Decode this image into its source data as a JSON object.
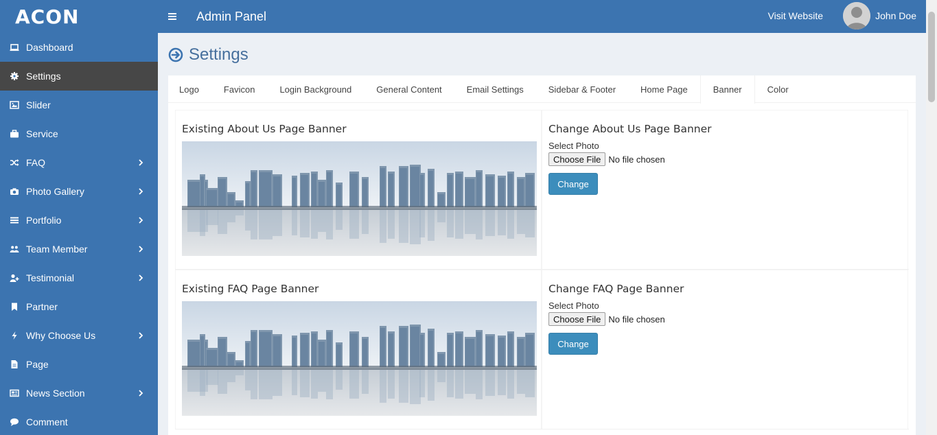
{
  "brand": "ACON",
  "header": {
    "title": "Admin Panel",
    "visit_label": "Visit Website",
    "user_name": "John Doe"
  },
  "sidebar": {
    "items": [
      {
        "label": "Dashboard",
        "icon": "laptop-icon",
        "has_children": false,
        "active": false
      },
      {
        "label": "Settings",
        "icon": "gear-icon",
        "has_children": false,
        "active": true
      },
      {
        "label": "Slider",
        "icon": "image-icon",
        "has_children": false,
        "active": false
      },
      {
        "label": "Service",
        "icon": "briefcase-icon",
        "has_children": false,
        "active": false
      },
      {
        "label": "FAQ",
        "icon": "shuffle-icon",
        "has_children": true,
        "active": false
      },
      {
        "label": "Photo Gallery",
        "icon": "camera-icon",
        "has_children": true,
        "active": false
      },
      {
        "label": "Portfolio",
        "icon": "list-icon",
        "has_children": true,
        "active": false
      },
      {
        "label": "Team Member",
        "icon": "users-icon",
        "has_children": true,
        "active": false
      },
      {
        "label": "Testimonial",
        "icon": "user-plus-icon",
        "has_children": true,
        "active": false
      },
      {
        "label": "Partner",
        "icon": "bookmark-icon",
        "has_children": false,
        "active": false
      },
      {
        "label": "Why Choose Us",
        "icon": "bolt-icon",
        "has_children": true,
        "active": false
      },
      {
        "label": "Page",
        "icon": "file-icon",
        "has_children": false,
        "active": false
      },
      {
        "label": "News Section",
        "icon": "newspaper-icon",
        "has_children": true,
        "active": false
      },
      {
        "label": "Comment",
        "icon": "comment-icon",
        "has_children": false,
        "active": false
      }
    ]
  },
  "page": {
    "title": "Settings"
  },
  "tabs": [
    "Logo",
    "Favicon",
    "Login Background",
    "General Content",
    "Email Settings",
    "Sidebar & Footer",
    "Home Page",
    "Banner",
    "Color"
  ],
  "active_tab": "Banner",
  "banners": [
    {
      "existing_title": "Existing About Us Page Banner",
      "change_title": "Change About Us Page Banner",
      "select_label": "Select Photo",
      "choose_label": "Choose File",
      "no_file": "No file chosen",
      "button": "Change"
    },
    {
      "existing_title": "Existing FAQ Page Banner",
      "change_title": "Change FAQ Page Banner",
      "select_label": "Select Photo",
      "choose_label": "Choose File",
      "no_file": "No file chosen",
      "button": "Change"
    }
  ],
  "colors": {
    "primary": "#3c74b0",
    "active_menu": "#474747",
    "button": "#3c8dbc",
    "background": "#ecf0f5"
  }
}
